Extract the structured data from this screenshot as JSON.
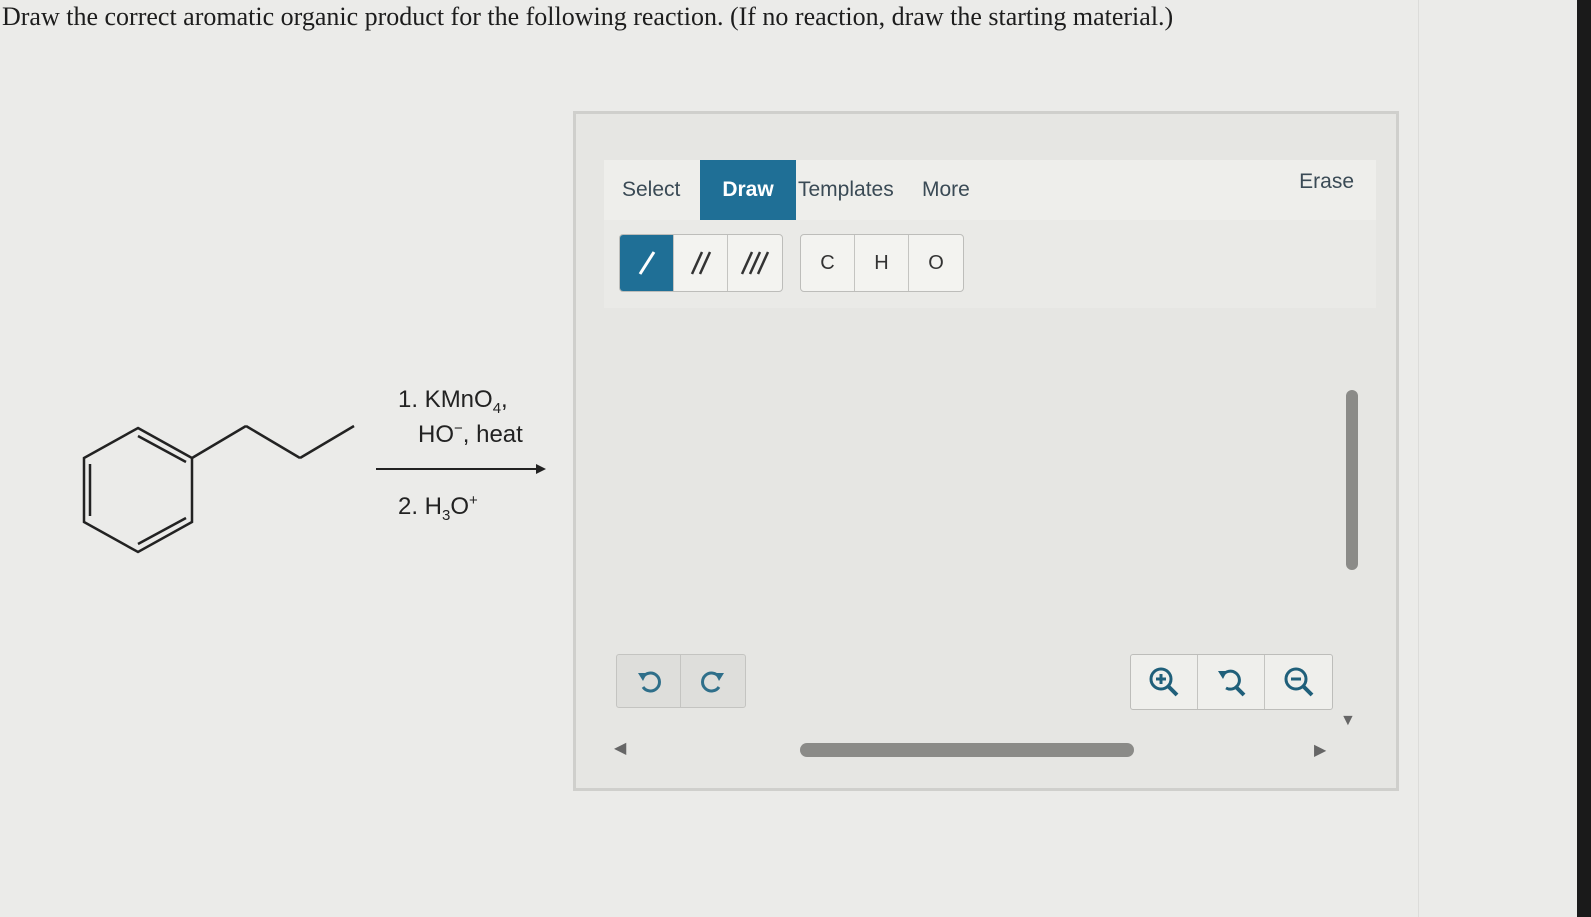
{
  "question": "Draw the correct aromatic organic product for the following reaction. (If no reaction, draw the starting material.)",
  "reaction": {
    "step1_label": "1. KMnO",
    "step1_sub": "4",
    "step1_tail": ",",
    "step1b_label": "HO",
    "step1b_sup": "−",
    "step1b_tail": ", heat",
    "step2_label": "2. H",
    "step2_sub": "3",
    "step2_mid": "O",
    "step2_sup": "+"
  },
  "sketcher": {
    "tabs": {
      "select": "Select",
      "draw": "Draw",
      "templates": "Templates",
      "more": "More",
      "erase": "Erase"
    },
    "bonds": [
      {
        "label": "/",
        "icon": "single-bond-icon"
      },
      {
        "label": "//",
        "icon": "double-bond-icon"
      },
      {
        "label": "///",
        "icon": "triple-bond-icon"
      }
    ],
    "atoms": [
      "C",
      "H",
      "O"
    ],
    "undo_icon": "undo-icon",
    "redo_icon": "redo-icon",
    "zoom_icons": [
      "zoom-in-icon",
      "zoom-reset-icon",
      "zoom-out-icon"
    ],
    "accent": "#1f6f96"
  }
}
